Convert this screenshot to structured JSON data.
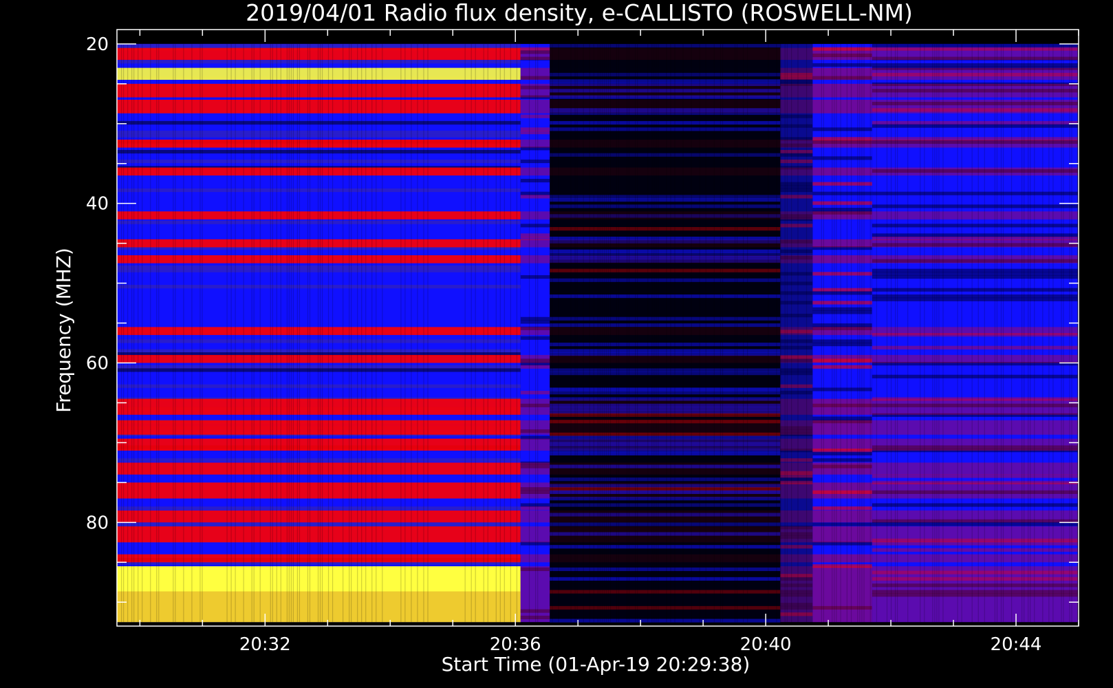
{
  "chart_data": {
    "type": "heatmap",
    "title": "2019/04/01  Radio flux density, e-CALLISTO (ROSWELL-NM)",
    "xlabel": "Start Time (01-Apr-19 20:29:38)",
    "ylabel": "Frequency (MHZ)",
    "x_range_minutes": [
      20.42,
      20.75
    ],
    "x_axis_start": "20:29:38",
    "x_axis_end": "20:45:00",
    "data_x_start": "20:29:38",
    "data_x_end": "20:44:59",
    "ylim": [
      93,
      18.2
    ],
    "data_y_range": [
      20,
      92.5
    ],
    "x_ticks": [
      "20:32",
      "20:36",
      "20:40",
      "20:44"
    ],
    "x_tick_values": [
      "20:32:00",
      "20:36:00",
      "20:40:00",
      "20:44:00"
    ],
    "x_minor_tick_values": [
      "20:30:00",
      "20:31:00",
      "20:33:00",
      "20:34:00",
      "20:35:00",
      "20:37:00",
      "20:38:00",
      "20:39:00",
      "20:41:00",
      "20:42:00",
      "20:43:00",
      "20:45:00"
    ],
    "y_ticks": [
      "20",
      "40",
      "60",
      "80"
    ],
    "y_tick_values": [
      20,
      40,
      60,
      80
    ],
    "y_minor_tick_values": [
      25,
      30,
      35,
      45,
      50,
      55,
      65,
      70,
      75,
      85,
      90
    ],
    "colormap": [
      "#000000",
      "#1010ff",
      "#ff0000",
      "#ffff40"
    ],
    "segments": [
      {
        "start": "20:29:38",
        "end": "20:36:05",
        "level": "high",
        "note": "strong red/yellow interference bands"
      },
      {
        "start": "20:36:05",
        "end": "20:36:33",
        "level": "medium"
      },
      {
        "start": "20:36:33",
        "end": "20:40:14",
        "level": "low",
        "note": "dark with blue speckle"
      },
      {
        "start": "20:40:14",
        "end": "20:40:45",
        "level": "mixed"
      },
      {
        "start": "20:40:45",
        "end": "20:41:42",
        "level": "elevated",
        "note": "broadband enhancement column"
      },
      {
        "start": "20:41:42",
        "end": "20:44:59",
        "level": "medium",
        "note": "blue background"
      }
    ],
    "bright_bands_mhz": [
      {
        "from": 20.5,
        "to": 22,
        "level": "red"
      },
      {
        "from": 23,
        "to": 24.5,
        "level": "yellow"
      },
      {
        "from": 25,
        "to": 26.7,
        "level": "red"
      },
      {
        "from": 27,
        "to": 28.7,
        "level": "red"
      },
      {
        "from": 32,
        "to": 33,
        "level": "red"
      },
      {
        "from": 35.5,
        "to": 36.5,
        "level": "red"
      },
      {
        "from": 41,
        "to": 42,
        "level": "red"
      },
      {
        "from": 44.5,
        "to": 45.5,
        "level": "red"
      },
      {
        "from": 46.5,
        "to": 47.5,
        "level": "red"
      },
      {
        "from": 55.5,
        "to": 56.5,
        "level": "red"
      },
      {
        "from": 59,
        "to": 60,
        "level": "red"
      },
      {
        "from": 64.5,
        "to": 66.5,
        "level": "red"
      },
      {
        "from": 67.2,
        "to": 69,
        "level": "red"
      },
      {
        "from": 69.5,
        "to": 71,
        "level": "red"
      },
      {
        "from": 72.5,
        "to": 74,
        "level": "red"
      },
      {
        "from": 75,
        "to": 77,
        "level": "red"
      },
      {
        "from": 78.5,
        "to": 80,
        "level": "red"
      },
      {
        "from": 80.5,
        "to": 82.5,
        "level": "red"
      },
      {
        "from": 84,
        "to": 85,
        "level": "red"
      },
      {
        "from": 85.5,
        "to": 92.5,
        "level": "yellow"
      }
    ]
  }
}
